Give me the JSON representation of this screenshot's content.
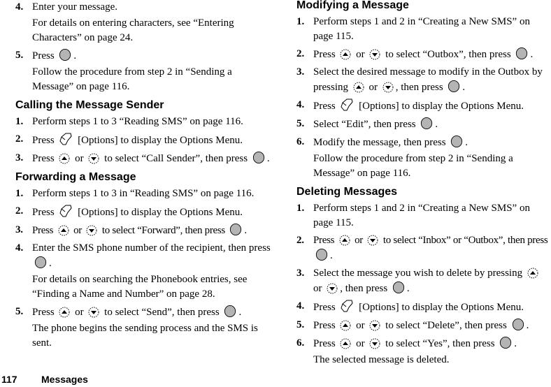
{
  "icons": {
    "center_key": "center-key-icon",
    "options_key": "options-softkey-icon",
    "up_key": "up-arrow-key-icon",
    "down_key": "down-arrow-key-icon"
  },
  "left": {
    "intro_steps": [
      {
        "num": "4.",
        "text": "Enter your message.",
        "note": "For details on entering characters, see “Entering Characters” on page 24."
      },
      {
        "num": "5.",
        "pre": "Press",
        "post": ".",
        "note": "Follow the procedure from step 2 in “Sending a Message” on page 116."
      }
    ],
    "calling": {
      "title": "Calling the Message Sender",
      "steps": [
        {
          "num": "1.",
          "text": "Perform steps 1 to 3 “Reading SMS” on page 116."
        },
        {
          "num": "2.",
          "pre": "Press",
          "post": "[Options] to display the Options Menu."
        },
        {
          "num": "3.",
          "pre": "Press",
          "or": "or",
          "mid": "to select “Call Sender”, then press",
          "post": "."
        }
      ]
    },
    "forwarding": {
      "title": "Forwarding a Message",
      "steps": [
        {
          "num": "1.",
          "text": "Perform steps 1 to 3 in “Reading SMS” on page 116."
        },
        {
          "num": "2.",
          "pre": "Press",
          "post": "[Options] to display the Options Menu."
        },
        {
          "num": "3.",
          "pre": "Press",
          "or": "or",
          "mid": "to select “Forward”, then press",
          "post": "."
        },
        {
          "num": "4.",
          "pre": "Enter the SMS phone number of the recipient, then press",
          "post": ".",
          "note": "For details on searching the Phonebook entries, see “Finding a Name and Number” on page 28."
        },
        {
          "num": "5.",
          "pre": "Press",
          "or": "or",
          "mid": "to select “Send”, then press",
          "post": ".",
          "note": "The phone begins the sending process and the SMS is sent."
        }
      ]
    }
  },
  "right": {
    "modifying": {
      "title": "Modifying a Message",
      "steps": [
        {
          "num": "1.",
          "text": "Perform steps 1 and 2 in “Creating a New SMS” on page 115."
        },
        {
          "num": "2.",
          "pre": "Press",
          "or": "or",
          "mid": "to select “Outbox”, then press",
          "post": "."
        },
        {
          "num": "3.",
          "pre": "Select the desired message to modify in the Outbox by pressing",
          "or": "or",
          "mid": ", then press",
          "post": "."
        },
        {
          "num": "4.",
          "pre": "Press",
          "post": "[Options] to display the Options Menu."
        },
        {
          "num": "5.",
          "pre": "Select “Edit”, then press",
          "post": "."
        },
        {
          "num": "6.",
          "pre": "Modify the message, then press",
          "post": ".",
          "note": "Follow the procedure from step 2 in “Sending a Message” on page 116."
        }
      ]
    },
    "deleting": {
      "title": "Deleting Messages",
      "steps": [
        {
          "num": "1.",
          "text": "Perform steps 1 and 2 in “Creating a New SMS” on page 115."
        },
        {
          "num": "2.",
          "pre": "Press",
          "or": "or",
          "mid": "to select “Inbox” or “Outbox”, then press",
          "post": "."
        },
        {
          "num": "3.",
          "pre": "Select the message you wish to delete by pressing",
          "or": "or",
          "mid": ", then press",
          "post": "."
        },
        {
          "num": "4.",
          "pre": "Press",
          "post": "[Options] to display the Options Menu."
        },
        {
          "num": "5.",
          "pre": "Press",
          "or": "or",
          "mid": "to select “Delete”, then press",
          "post": "."
        },
        {
          "num": "6.",
          "pre": "Press",
          "or": "or",
          "mid": "to select “Yes”, then press",
          "post": ".",
          "note": "The selected message is deleted."
        }
      ]
    }
  },
  "footer": {
    "page_number": "117",
    "section": "Messages"
  }
}
